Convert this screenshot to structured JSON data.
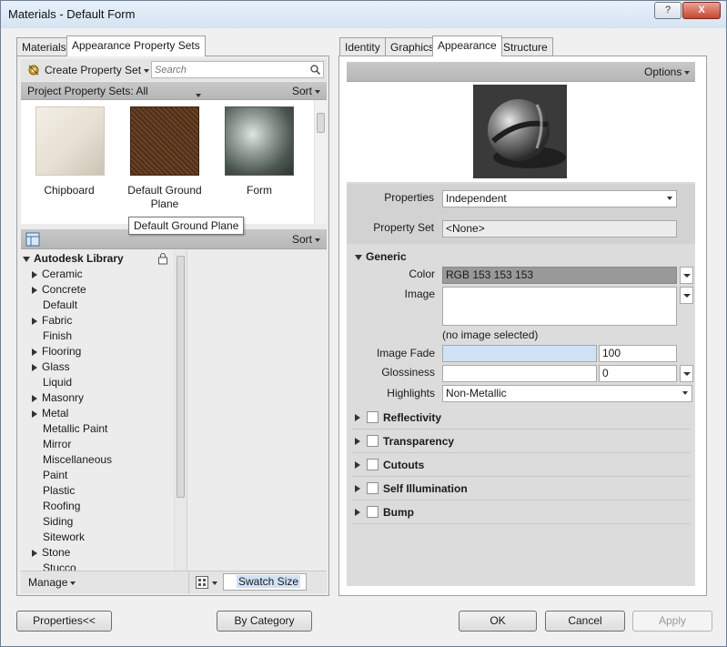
{
  "window": {
    "title": "Materials - Default Form",
    "help_btn": "?",
    "close_btn": "X"
  },
  "left": {
    "tabs": [
      "Materials",
      "Appearance Property Sets"
    ],
    "create_label": "Create Property Set",
    "search_placeholder": "Search",
    "filter_label": "Project Property Sets: All",
    "sort_label": "Sort",
    "thumbs": [
      {
        "label": "Chipboard"
      },
      {
        "label": "Default Ground Plane"
      },
      {
        "label": "Form"
      }
    ],
    "tooltip": "Default Ground Plane",
    "library": {
      "title": "Autodesk Library",
      "sort_label": "Sort",
      "items": [
        {
          "label": "Ceramic",
          "expandable": true
        },
        {
          "label": "Concrete",
          "expandable": true
        },
        {
          "label": "Default",
          "expandable": false
        },
        {
          "label": "Fabric",
          "expandable": true
        },
        {
          "label": "Finish",
          "expandable": false
        },
        {
          "label": "Flooring",
          "expandable": true
        },
        {
          "label": "Glass",
          "expandable": true
        },
        {
          "label": "Liquid",
          "expandable": false
        },
        {
          "label": "Masonry",
          "expandable": true
        },
        {
          "label": "Metal",
          "expandable": true
        },
        {
          "label": "Metallic Paint",
          "expandable": false
        },
        {
          "label": "Mirror",
          "expandable": false
        },
        {
          "label": "Miscellaneous",
          "expandable": false
        },
        {
          "label": "Paint",
          "expandable": false
        },
        {
          "label": "Plastic",
          "expandable": false
        },
        {
          "label": "Roofing",
          "expandable": false
        },
        {
          "label": "Siding",
          "expandable": false
        },
        {
          "label": "Sitework",
          "expandable": false
        },
        {
          "label": "Stone",
          "expandable": true
        },
        {
          "label": "Stucco",
          "expandable": false
        }
      ]
    },
    "manage_label": "Manage",
    "swatch_label": "Swatch Size"
  },
  "right": {
    "tabs": [
      "Identity",
      "Graphics",
      "Appearance",
      "Structure"
    ],
    "options_label": "Options",
    "properties_label": "Properties",
    "properties_value": "Independent",
    "property_set_label": "Property Set",
    "property_set_value": "<None>",
    "generic_label": "Generic",
    "color_label": "Color",
    "color_value": "RGB 153 153 153",
    "image_label": "Image",
    "no_image": "(no image selected)",
    "image_fade_label": "Image Fade",
    "image_fade_value": "100",
    "glossiness_label": "Glossiness",
    "glossiness_value": "0",
    "highlights_label": "Highlights",
    "highlights_value": "Non-Metallic",
    "sections": [
      "Reflectivity",
      "Transparency",
      "Cutouts",
      "Self Illumination",
      "Bump"
    ]
  },
  "buttons": {
    "properties": "Properties<<",
    "by_category": "By Category",
    "ok": "OK",
    "cancel": "Cancel",
    "apply": "Apply"
  },
  "colors": {
    "color_swatch": "#999999",
    "image_fade_fill": "#cfe2f6",
    "section_bg": "#dcdcdc"
  }
}
